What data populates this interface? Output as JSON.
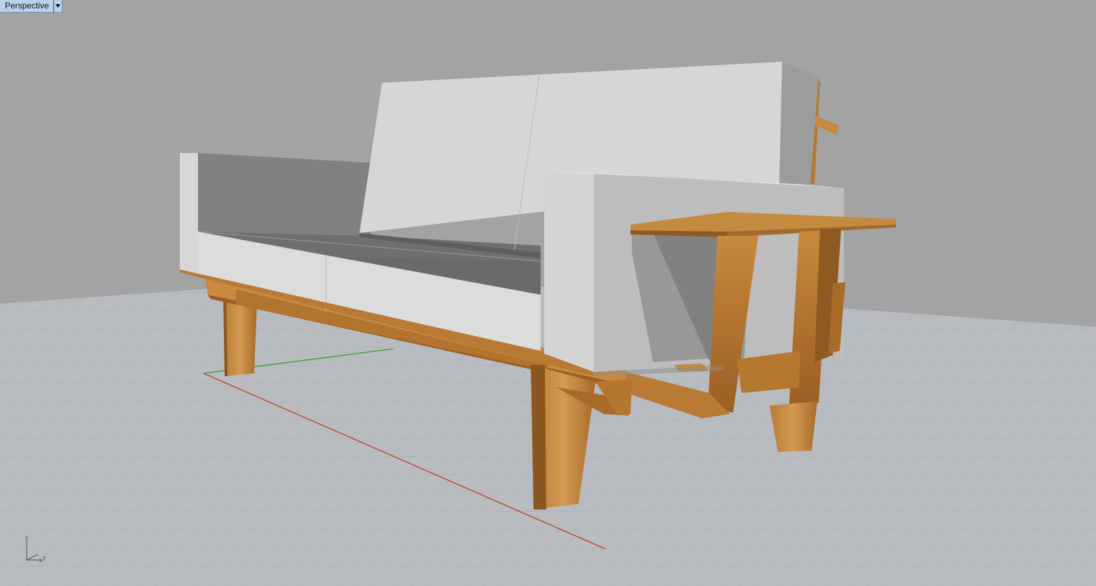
{
  "viewport": {
    "title": "Perspective",
    "menu_icon": "dropdown-triangle-icon"
  },
  "axes_indicator": {
    "z_label": "z",
    "y_label": "y",
    "x_label": "x"
  },
  "colors": {
    "background": "#a3a3a3",
    "grid_plane": "#b9bcc0",
    "grid_line": "#9ea1a5",
    "grid_major": "#8f9296",
    "x_axis": "#c23a2a",
    "y_axis": "#2fa32f",
    "cushion_light": "#d3d3d3",
    "cushion_mid": "#bebebe",
    "cushion_dark": "#7f7f7f",
    "wood_light": "#c8883c",
    "wood_mid": "#a8692a",
    "wood_dark": "#7a4a1a",
    "tab_active": "#b9d1ea"
  }
}
